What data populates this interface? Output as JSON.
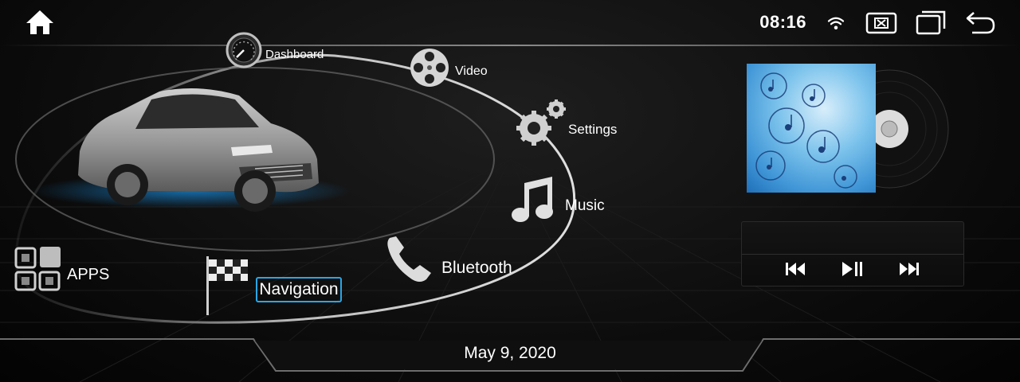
{
  "status_bar": {
    "time": "08:16",
    "icons": [
      "home-icon",
      "wifi-icon",
      "close-app-icon",
      "window-switch-icon",
      "back-icon"
    ]
  },
  "menu": {
    "dashboard": "Dashboard",
    "video": "Video",
    "settings": "Settings",
    "music": "Music",
    "bluetooth": "Bluetooth",
    "navigation": "Navigation",
    "apps": "APPS"
  },
  "player": {
    "controls": [
      "previous-track-icon",
      "play-pause-icon",
      "next-track-icon"
    ]
  },
  "footer": {
    "date": "May 9, 2020"
  },
  "colors": {
    "accent": "#2aa6e6",
    "background": "#050505",
    "text": "#ffffff"
  }
}
